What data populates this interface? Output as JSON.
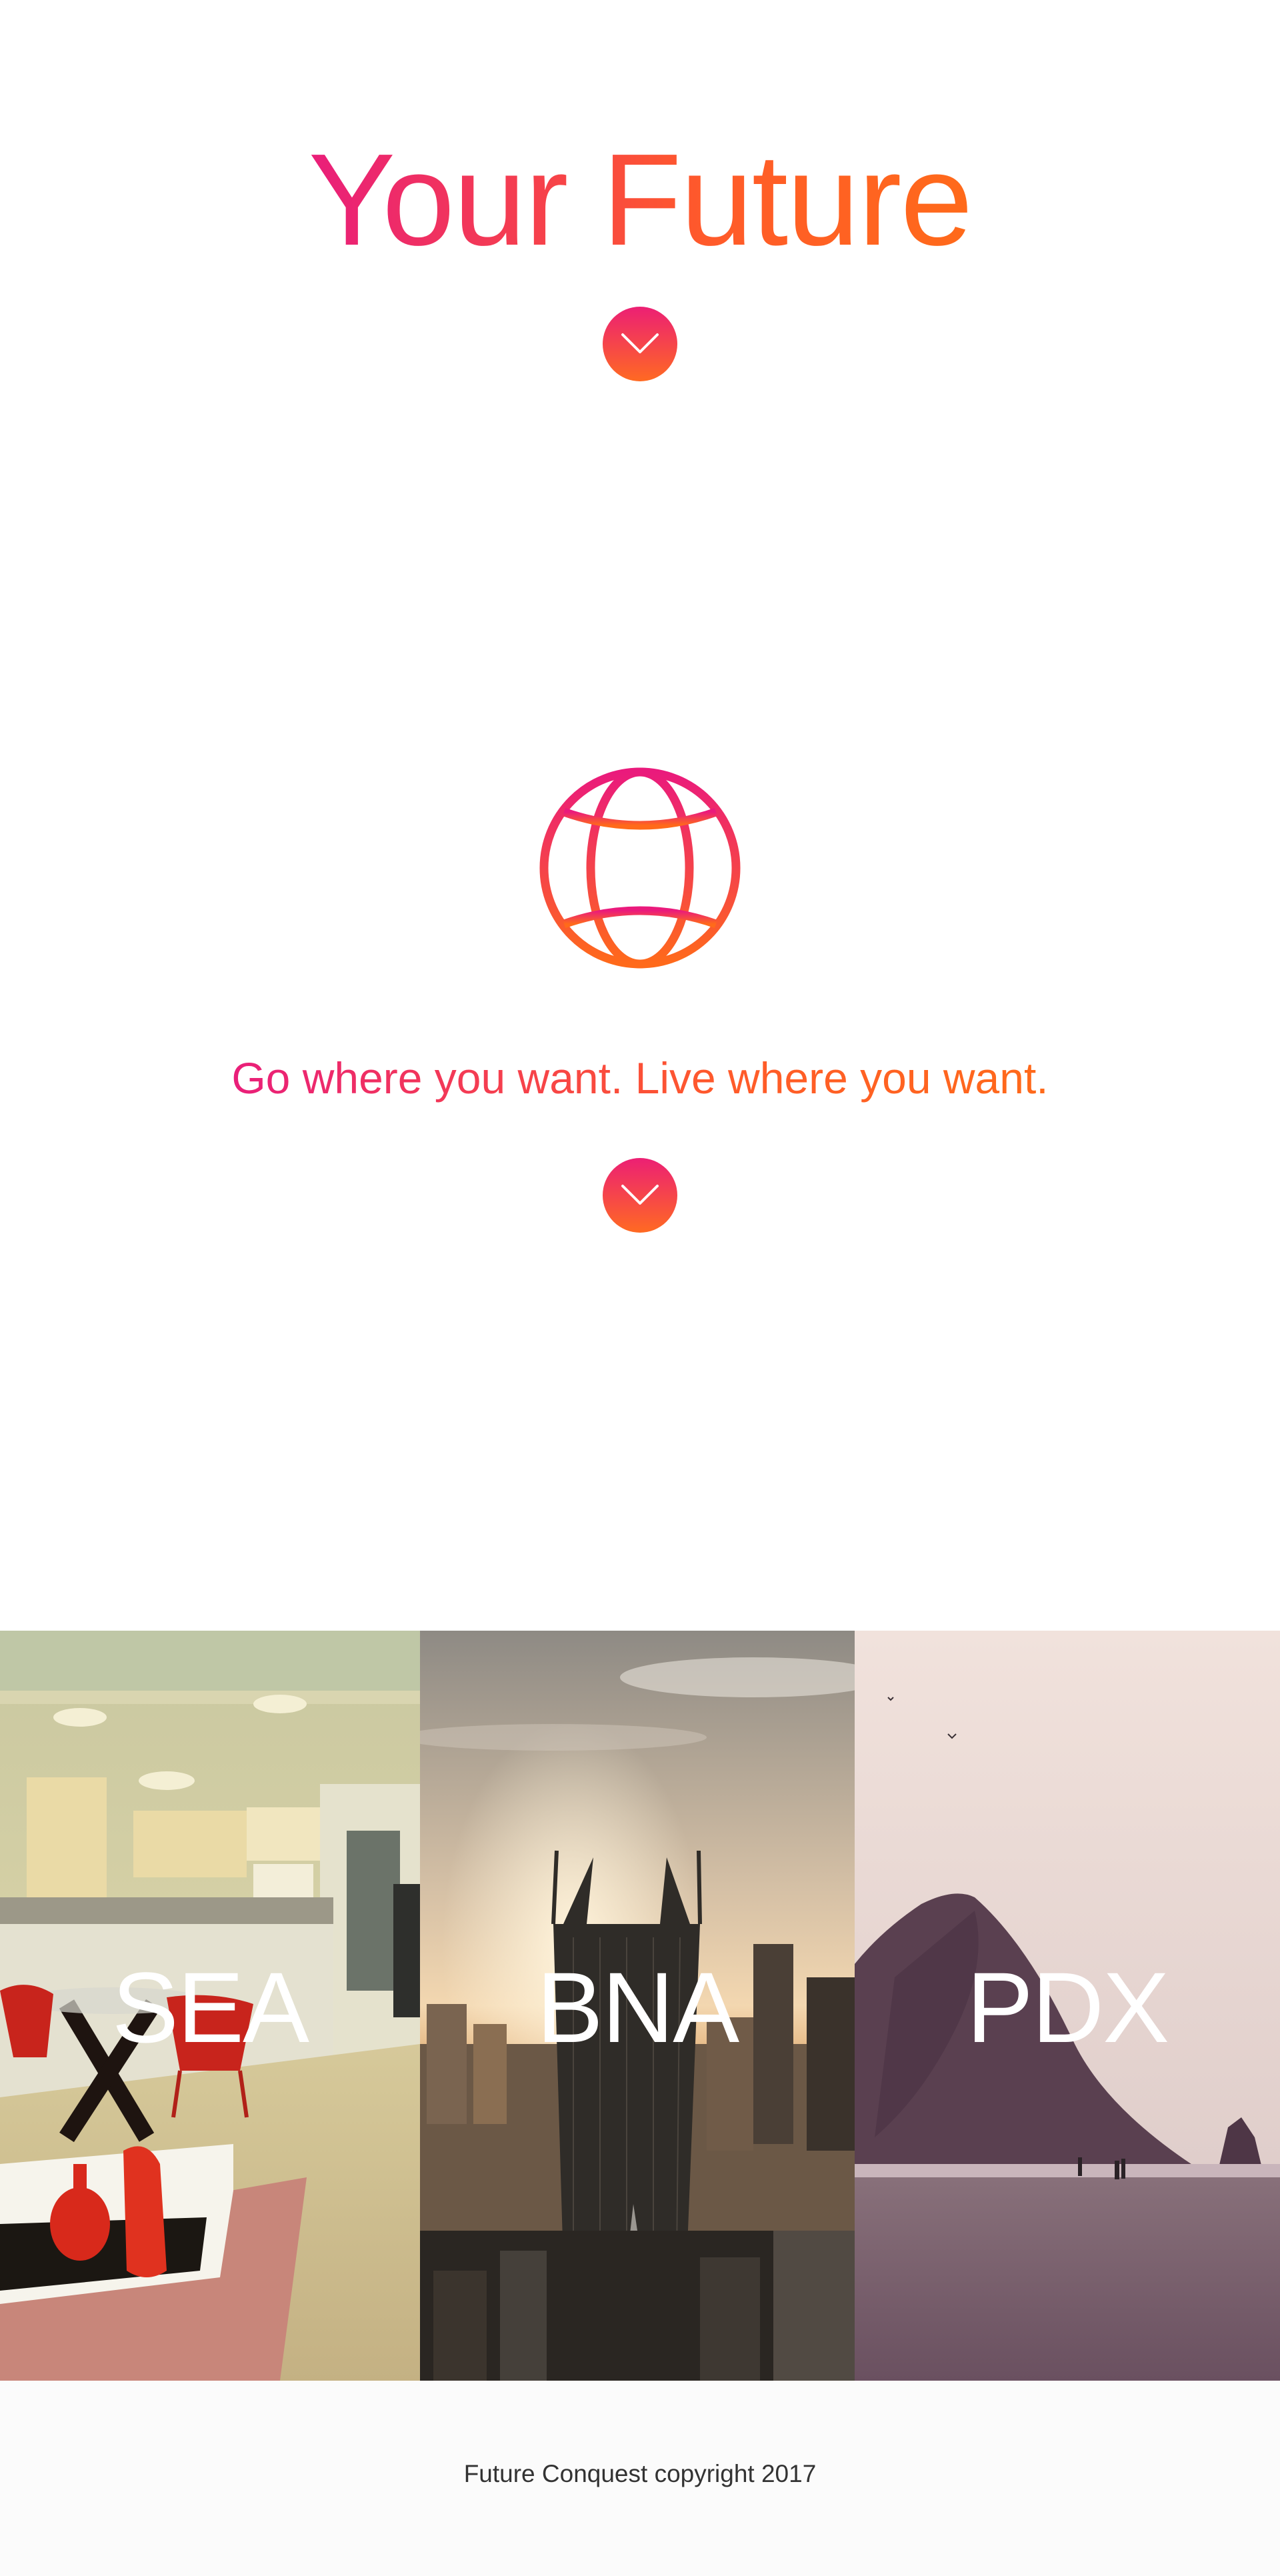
{
  "hero": {
    "title": "Your Future"
  },
  "section_globe": {
    "tagline": "Go where you want. Live where you want.",
    "icon": "globe-icon"
  },
  "scroll_buttons": {
    "icon": "chevron-down-icon"
  },
  "cities": [
    {
      "label": "SEA",
      "scene": "apartment interior"
    },
    {
      "label": "BNA",
      "scene": "city skyline at sunset"
    },
    {
      "label": "PDX",
      "scene": "coastal rock on beach"
    }
  ],
  "footer": {
    "text": "Future Conquest copyright 2017"
  },
  "colors": {
    "gradient_start": "#e91e7a",
    "gradient_end": "#ff6a1a",
    "footer_background": "#fbfbfb",
    "footer_text": "#333333"
  }
}
